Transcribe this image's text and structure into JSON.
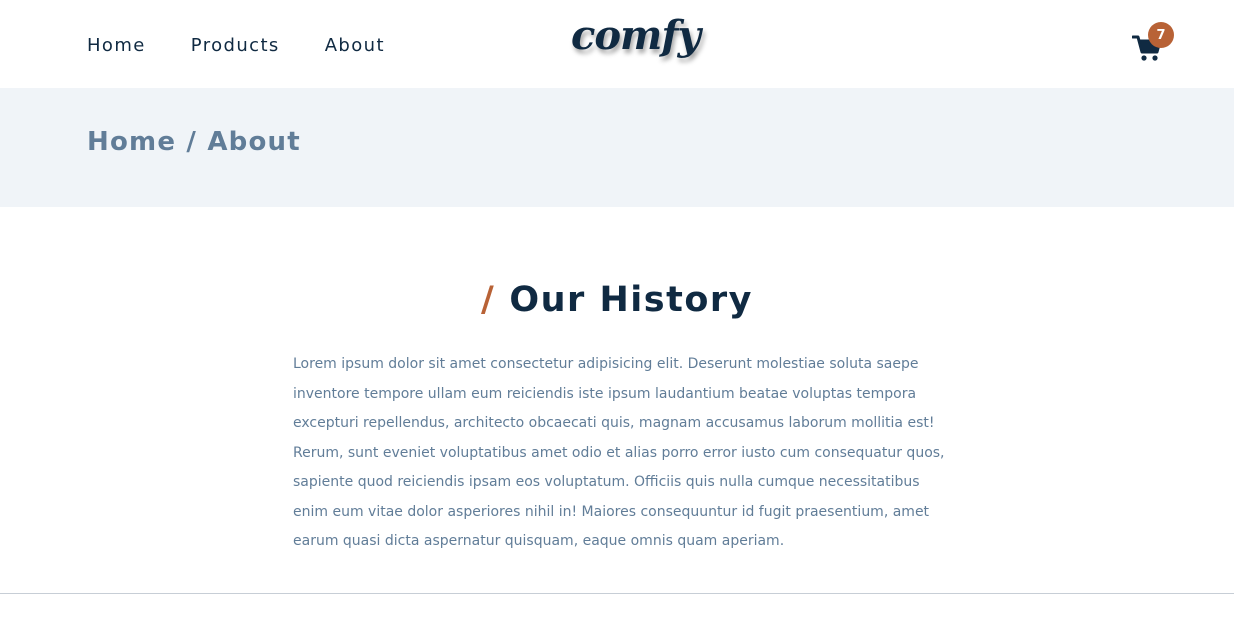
{
  "nav": {
    "links": [
      "Home",
      "Products",
      "About"
    ],
    "logo": "comfy",
    "cart": {
      "icon": "cart-icon",
      "count": "7"
    }
  },
  "hero": {
    "breadcrumb": "Home / About"
  },
  "about": {
    "title_slash": "/",
    "title": "Our History",
    "text": "Lorem ipsum dolor sit amet consectetur adipisicing elit. Deserunt molestiae soluta saepe inventore tempore ullam eum reiciendis iste ipsum laudantium beatae voluptas tempora excepturi repellendus, architecto obcaecati quis, magnam accusamus laborum mollitia est! Rerum, sunt eveniet voluptatibus amet odio et alias porro error iusto cum consequatur quos, sapiente quod reiciendis ipsam eos voluptatum. Officiis quis nulla cumque necessitatibus enim eum vitae dolor asperiores nihil in! Maiores consequuntur id fugit praesentium, amet earum quasi dicta aspernatur quisquam, eaque omnis quam aperiam."
  },
  "colors": {
    "primary_dark": "#102a42",
    "accent": "#b86236",
    "muted_text": "#617d98",
    "hero_bg": "#f0f4f8"
  }
}
